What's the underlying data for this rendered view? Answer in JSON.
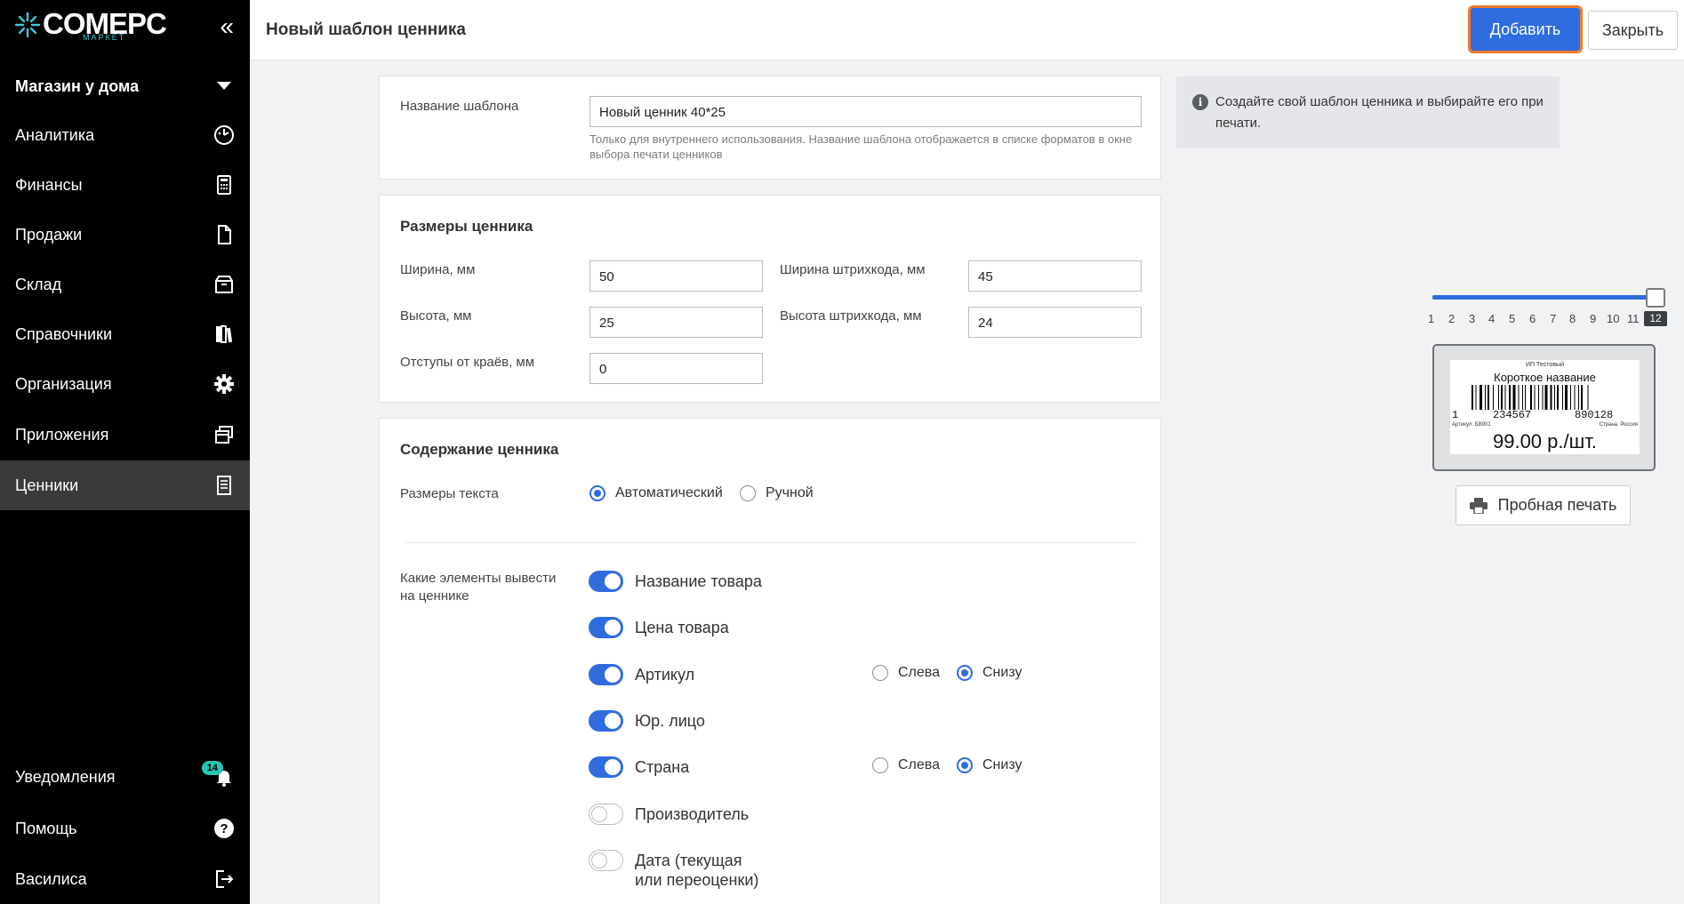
{
  "sidebar": {
    "logo": "COMEPC",
    "logo_sub": "МАРКЕТ",
    "store": "Магазин у дома",
    "items": [
      {
        "label": "Аналитика",
        "icon": "analytics-icon"
      },
      {
        "label": "Финансы",
        "icon": "calculator-icon"
      },
      {
        "label": "Продажи",
        "icon": "document-icon"
      },
      {
        "label": "Склад",
        "icon": "box-icon"
      },
      {
        "label": "Справочники",
        "icon": "books-icon"
      },
      {
        "label": "Организация",
        "icon": "gear-icon"
      },
      {
        "label": "Приложения",
        "icon": "windows-icon"
      },
      {
        "label": "Ценники",
        "icon": "receipt-icon",
        "active": true
      }
    ],
    "bottom": [
      {
        "label": "Уведомления",
        "icon": "bell-icon",
        "badge": "14"
      },
      {
        "label": "Помощь",
        "icon": "help-icon"
      },
      {
        "label": "Василиса",
        "icon": "logout-icon"
      }
    ]
  },
  "header": {
    "title": "Новый шаблон ценника",
    "add_label": "Добавить",
    "close_label": "Закрыть"
  },
  "template_name": {
    "label": "Название шаблона",
    "value": "Новый ценник 40*25",
    "hint": "Только для внутреннего использования. Название шаблона отображается в списке форматов в окне выбора печати ценников"
  },
  "sizes": {
    "title": "Размеры ценника",
    "width_label": "Ширина, мм",
    "width_value": "50",
    "height_label": "Высота, мм",
    "height_value": "25",
    "margin_label": "Отступы от краёв, мм",
    "margin_value": "0",
    "barcode_width_label": "Ширина штрихкода, мм",
    "barcode_width_value": "45",
    "barcode_height_label": "Высота штрихкода, мм",
    "barcode_height_value": "24"
  },
  "content": {
    "title": "Содержание ценника",
    "text_size_label": "Размеры текста",
    "text_size_options": [
      "Автоматический",
      "Ручной"
    ],
    "text_size_selected": "Автоматический",
    "elements_label": "Какие элементы вывести на ценнике",
    "elements": [
      {
        "label": "Название товара",
        "on": true
      },
      {
        "label": "Цена товара",
        "on": true
      },
      {
        "label": "Артикул",
        "on": true,
        "position": "Снизу"
      },
      {
        "label": "Юр. лицо",
        "on": true
      },
      {
        "label": "Страна",
        "on": true,
        "position": "Снизу"
      },
      {
        "label": "Производитель",
        "on": false
      },
      {
        "label": "Дата (текущая или переоценки)",
        "on": false
      }
    ],
    "position_options": [
      "Слева",
      "Снизу"
    ]
  },
  "info": {
    "text": "Создайте свой шаблон ценника и выбирайте его при печати."
  },
  "zoom": {
    "ticks": [
      "1",
      "2",
      "3",
      "4",
      "5",
      "6",
      "7",
      "8",
      "9",
      "10",
      "11",
      "12"
    ],
    "value": "12"
  },
  "preview": {
    "org": "ИП Тестовый",
    "name": "Короткое название",
    "barcode_first": "1",
    "barcode_left": "234567",
    "barcode_right": "890128",
    "article": "Артикул: БВ901",
    "country": "Страна: Россия",
    "price": "99.00 р./шт."
  },
  "print_button": "Пробная печать",
  "colors": {
    "accent": "#2f6dde",
    "highlight": "#f27a2a",
    "sidebar_bg": "#000000",
    "badge": "#26c6b3"
  }
}
